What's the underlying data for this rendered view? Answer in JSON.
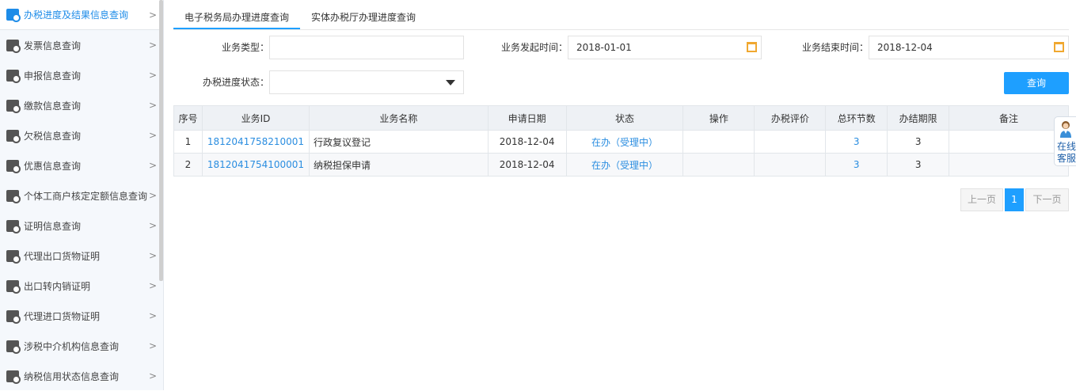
{
  "sidebar": {
    "items": [
      {
        "label": "办税进度及结果信息查询",
        "active": true
      },
      {
        "label": "发票信息查询"
      },
      {
        "label": "申报信息查询"
      },
      {
        "label": "缴款信息查询"
      },
      {
        "label": "欠税信息查询"
      },
      {
        "label": "优惠信息查询"
      },
      {
        "label": "个体工商户核定定额信息查询"
      },
      {
        "label": "证明信息查询"
      },
      {
        "label": "代理出口货物证明"
      },
      {
        "label": "出口转内销证明"
      },
      {
        "label": "代理进口货物证明"
      },
      {
        "label": "涉税中介机构信息查询"
      },
      {
        "label": "纳税信用状态信息查询"
      }
    ]
  },
  "tabs": [
    {
      "label": "电子税务局办理进度查询",
      "active": true
    },
    {
      "label": "实体办税厅办理进度查询"
    }
  ],
  "form": {
    "business_type": {
      "label": "业务类型：",
      "value": ""
    },
    "start_time": {
      "label": "业务发起时间：",
      "value": "2018-01-01"
    },
    "end_time": {
      "label": "业务结束时间：",
      "value": "2018-12-04"
    },
    "status": {
      "label": "办税进度状态：",
      "value": ""
    },
    "query_label": "查询"
  },
  "table": {
    "headers": [
      "序号",
      "业务ID",
      "业务名称",
      "申请日期",
      "状态",
      "操作",
      "办税评价",
      "总环节数",
      "办结期限",
      "备注"
    ],
    "rows": [
      [
        "1",
        "181204175821000​1",
        "行政复议登记",
        "2018-12-04",
        "在办（受理中）",
        "",
        "",
        "3",
        "3",
        ""
      ],
      [
        "2",
        "1812041754100001",
        "纳税担保申请",
        "2018-12-04",
        "在办（受理中）",
        "",
        "",
        "3",
        "3",
        ""
      ]
    ]
  },
  "pagination": {
    "prev": "上一页",
    "current": "1",
    "next": "下一页"
  },
  "chat": {
    "line1": "在线",
    "line2": "客服"
  },
  "colors": {
    "accent": "#1e9fff",
    "link": "#2a8de0"
  }
}
